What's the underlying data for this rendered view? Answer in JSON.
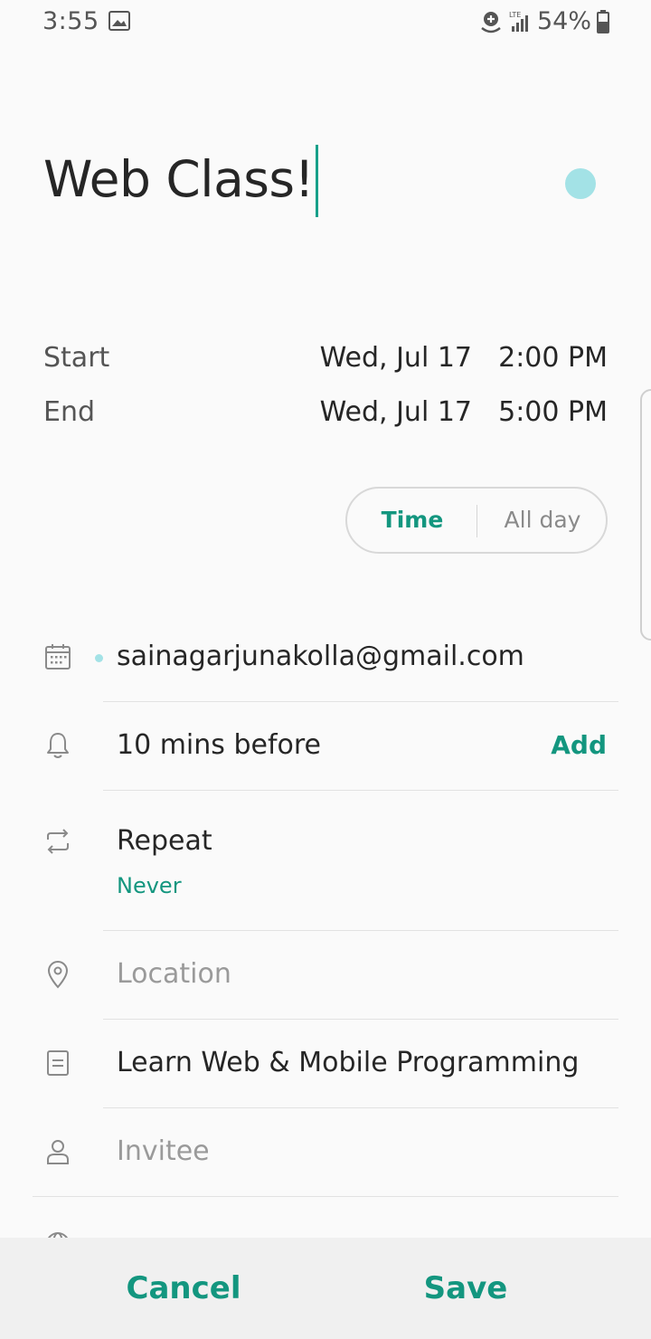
{
  "status_bar": {
    "time": "3:55",
    "network": "LTE",
    "battery": "54%"
  },
  "event": {
    "title": "Web Class!",
    "color": "#a3e2e6"
  },
  "schedule": {
    "start_label": "Start",
    "start_date": "Wed, Jul 17",
    "start_time": "2:00 PM",
    "end_label": "End",
    "end_date": "Wed, Jul 17",
    "end_time": "5:00 PM"
  },
  "mode_toggle": {
    "time_label": "Time",
    "allday_label": "All day",
    "selected": "Time"
  },
  "fields": {
    "calendar_account": "sainagarjunakolla@gmail.com",
    "reminder": "10 mins before",
    "reminder_add": "Add",
    "repeat_label": "Repeat",
    "repeat_value": "Never",
    "location_placeholder": "Location",
    "notes": "Learn Web & Mobile Programming",
    "invitee_placeholder": "Invitee"
  },
  "actions": {
    "cancel": "Cancel",
    "save": "Save"
  },
  "colors": {
    "accent": "#13967f",
    "event_color": "#a3e2e6"
  }
}
